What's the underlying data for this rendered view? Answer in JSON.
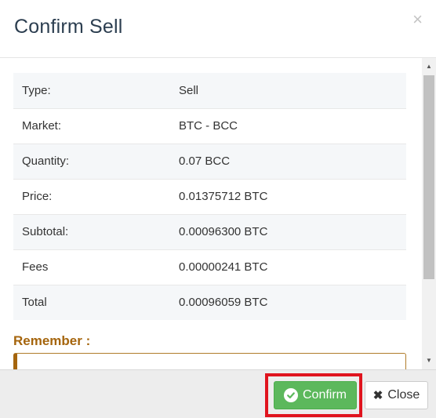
{
  "modal": {
    "title": "Confirm Sell",
    "close_glyph": "×"
  },
  "details": [
    {
      "label": "Type:",
      "value": "Sell"
    },
    {
      "label": "Market:",
      "value": "BTC - BCC"
    },
    {
      "label": "Quantity:",
      "value": "0.07 BCC"
    },
    {
      "label": "Price:",
      "value": "0.01375712 BTC"
    },
    {
      "label": "Subtotal:",
      "value": "0.00096300 BTC"
    },
    {
      "label": "Fees",
      "value": "0.00000241 BTC"
    },
    {
      "label": "Total",
      "value": "0.00096059 BTC"
    }
  ],
  "remember": {
    "label": "Remember :",
    "box_text": ""
  },
  "scrollbar": {
    "up_glyph": "▲",
    "down_glyph": "▼"
  },
  "footer": {
    "confirm_label": "Confirm",
    "close_label": "Close"
  },
  "colors": {
    "confirm_bg": "#5cb85c",
    "highlight": "#e0141e",
    "remember": "#a5650d",
    "title": "#2c3e50"
  },
  "icons": {
    "confirm": "check-circle-icon",
    "close": "times-icon",
    "dismiss": "close-icon"
  }
}
